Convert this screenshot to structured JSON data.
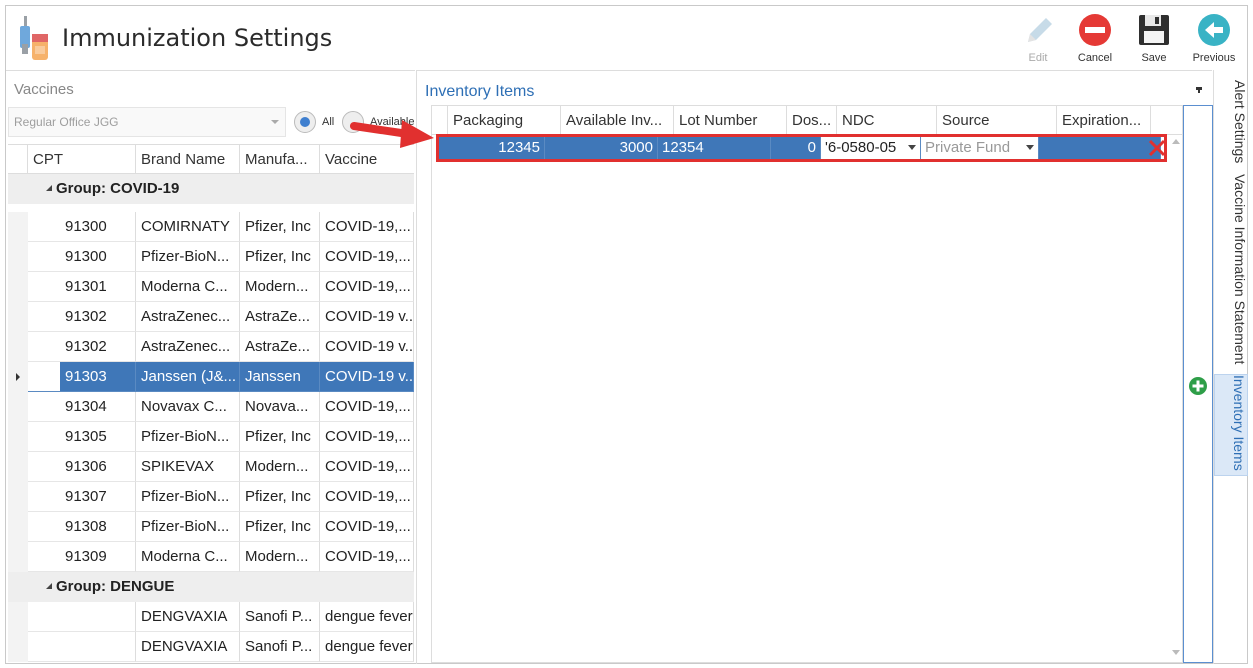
{
  "header": {
    "title": "Immunization Settings",
    "toolbar": [
      {
        "label": "Edit",
        "icon": "pencil-icon",
        "enabled": false
      },
      {
        "label": "Cancel",
        "icon": "cancel-icon",
        "enabled": true
      },
      {
        "label": "Save",
        "icon": "floppy-disk-icon",
        "enabled": true
      },
      {
        "label": "Previous",
        "icon": "arrow-left-icon",
        "enabled": true
      }
    ]
  },
  "vaccines": {
    "title": "Vaccines",
    "office_select": "Regular Office JGG",
    "filter_all": "All",
    "filter_available": "Available",
    "columns": [
      "CPT",
      "Brand Name",
      "Manufa...",
      "Vaccine"
    ],
    "groups": [
      {
        "name": "Group: COVID-19",
        "rows": [
          {
            "cpt": "91300",
            "brand": "COMIRNATY",
            "mfr": "Pfizer, Inc",
            "vaccine": "COVID-19,..."
          },
          {
            "cpt": "91300",
            "brand": "Pfizer-BioN...",
            "mfr": "Pfizer, Inc",
            "vaccine": "COVID-19,..."
          },
          {
            "cpt": "91301",
            "brand": "Moderna C...",
            "mfr": "Modern...",
            "vaccine": "COVID-19,..."
          },
          {
            "cpt": "91302",
            "brand": "AstraZenec...",
            "mfr": "AstraZe...",
            "vaccine": "COVID-19 v..."
          },
          {
            "cpt": "91302",
            "brand": "AstraZenec...",
            "mfr": "AstraZe...",
            "vaccine": "COVID-19 v..."
          },
          {
            "cpt": "91303",
            "brand": "Janssen (J&...",
            "mfr": "Janssen",
            "vaccine": "COVID-19 v...",
            "selected": true
          },
          {
            "cpt": "91304",
            "brand": "Novavax C...",
            "mfr": "Novava...",
            "vaccine": "COVID-19,..."
          },
          {
            "cpt": "91305",
            "brand": "Pfizer-BioN...",
            "mfr": "Pfizer, Inc",
            "vaccine": "COVID-19,..."
          },
          {
            "cpt": "91306",
            "brand": "SPIKEVAX",
            "mfr": "Modern...",
            "vaccine": "COVID-19,..."
          },
          {
            "cpt": "91307",
            "brand": "Pfizer-BioN...",
            "mfr": "Pfizer, Inc",
            "vaccine": "COVID-19,..."
          },
          {
            "cpt": "91308",
            "brand": "Pfizer-BioN...",
            "mfr": "Pfizer, Inc",
            "vaccine": "COVID-19,..."
          },
          {
            "cpt": "91309",
            "brand": "Moderna C...",
            "mfr": "Modern...",
            "vaccine": "COVID-19,..."
          }
        ]
      },
      {
        "name": "Group: DENGUE",
        "rows": [
          {
            "cpt": "",
            "brand": "DENGVAXIA",
            "mfr": "Sanofi P...",
            "vaccine": "dengue fever"
          },
          {
            "cpt": "",
            "brand": "DENGVAXIA",
            "mfr": "Sanofi P...",
            "vaccine": "dengue fever"
          }
        ]
      }
    ]
  },
  "inventory": {
    "title": "Inventory Items",
    "columns": [
      "Packaging",
      "Available Inv...",
      "Lot Number",
      "Dos...",
      "NDC",
      "Source",
      "Expiration..."
    ],
    "row": {
      "packaging": "12345",
      "available": "3000",
      "lot": "12354",
      "dose": "0",
      "ndc": "'6-0580-05",
      "source": "Private Fund",
      "expiration": ""
    }
  },
  "side_tabs": [
    "Alert Settings",
    "Vaccine Information Statement",
    "Inventory Items"
  ],
  "colors": {
    "accent": "#3f77b8",
    "highlight": "#e1302f",
    "active_tab": "#dbe8f7"
  }
}
